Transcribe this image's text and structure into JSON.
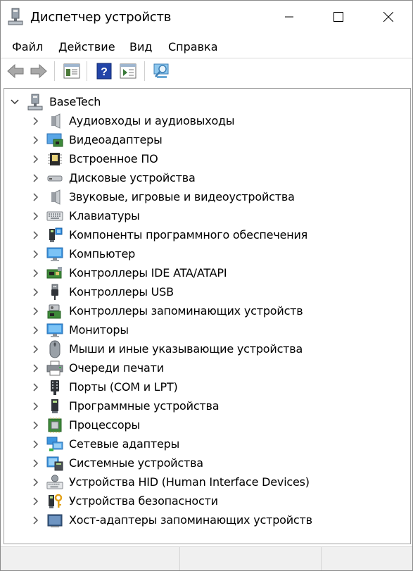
{
  "window": {
    "title": "Диспетчер устройств",
    "controls": {
      "minimize": "minimize-icon",
      "maximize": "maximize-icon",
      "close": "close-icon"
    }
  },
  "menu": {
    "items": [
      {
        "label": "Файл"
      },
      {
        "label": "Действие"
      },
      {
        "label": "Вид"
      },
      {
        "label": "Справка"
      }
    ]
  },
  "toolbar": {
    "buttons": [
      "back-arrow-icon",
      "forward-arrow-icon",
      "properties-icon",
      "help-icon",
      "view-icon",
      "scan-hardware-icon"
    ]
  },
  "tree": {
    "root": {
      "label": "BaseTech",
      "icon": "computer-root-icon",
      "expanded": true
    },
    "categories": [
      {
        "label": "Аудиовходы и аудиовыходы",
        "icon": "speaker-icon"
      },
      {
        "label": "Видеоадаптеры",
        "icon": "display-adapter-icon"
      },
      {
        "label": "Встроенное ПО",
        "icon": "firmware-chip-icon"
      },
      {
        "label": "Дисковые устройства",
        "icon": "disk-drive-icon"
      },
      {
        "label": "Звуковые, игровые и видеоустройства",
        "icon": "sound-icon"
      },
      {
        "label": "Клавиатуры",
        "icon": "keyboard-icon"
      },
      {
        "label": "Компоненты программного обеспечения",
        "icon": "software-component-icon"
      },
      {
        "label": "Компьютер",
        "icon": "monitor-icon"
      },
      {
        "label": "Контроллеры IDE ATA/ATAPI",
        "icon": "ide-controller-icon"
      },
      {
        "label": "Контроллеры USB",
        "icon": "usb-icon"
      },
      {
        "label": "Контроллеры запоминающих устройств",
        "icon": "storage-controller-icon"
      },
      {
        "label": "Мониторы",
        "icon": "monitor-icon"
      },
      {
        "label": "Мыши и иные указывающие устройства",
        "icon": "mouse-icon"
      },
      {
        "label": "Очереди печати",
        "icon": "printer-icon"
      },
      {
        "label": "Порты (COM и LPT)",
        "icon": "port-icon"
      },
      {
        "label": "Программные устройства",
        "icon": "software-device-icon"
      },
      {
        "label": "Процессоры",
        "icon": "processor-icon"
      },
      {
        "label": "Сетевые адаптеры",
        "icon": "network-adapter-icon"
      },
      {
        "label": "Системные устройства",
        "icon": "system-device-icon"
      },
      {
        "label": "Устройства HID (Human Interface Devices)",
        "icon": "hid-icon"
      },
      {
        "label": "Устройства безопасности",
        "icon": "security-device-icon"
      },
      {
        "label": "Хост-адаптеры запоминающих устройств",
        "icon": "storage-host-adapter-icon"
      }
    ]
  },
  "colors": {
    "accent_blue": "#1e78d7",
    "arrow_gray": "#8c8c8c",
    "tree_border": "#a0a0a0",
    "status_bg": "#f0f0f0"
  }
}
